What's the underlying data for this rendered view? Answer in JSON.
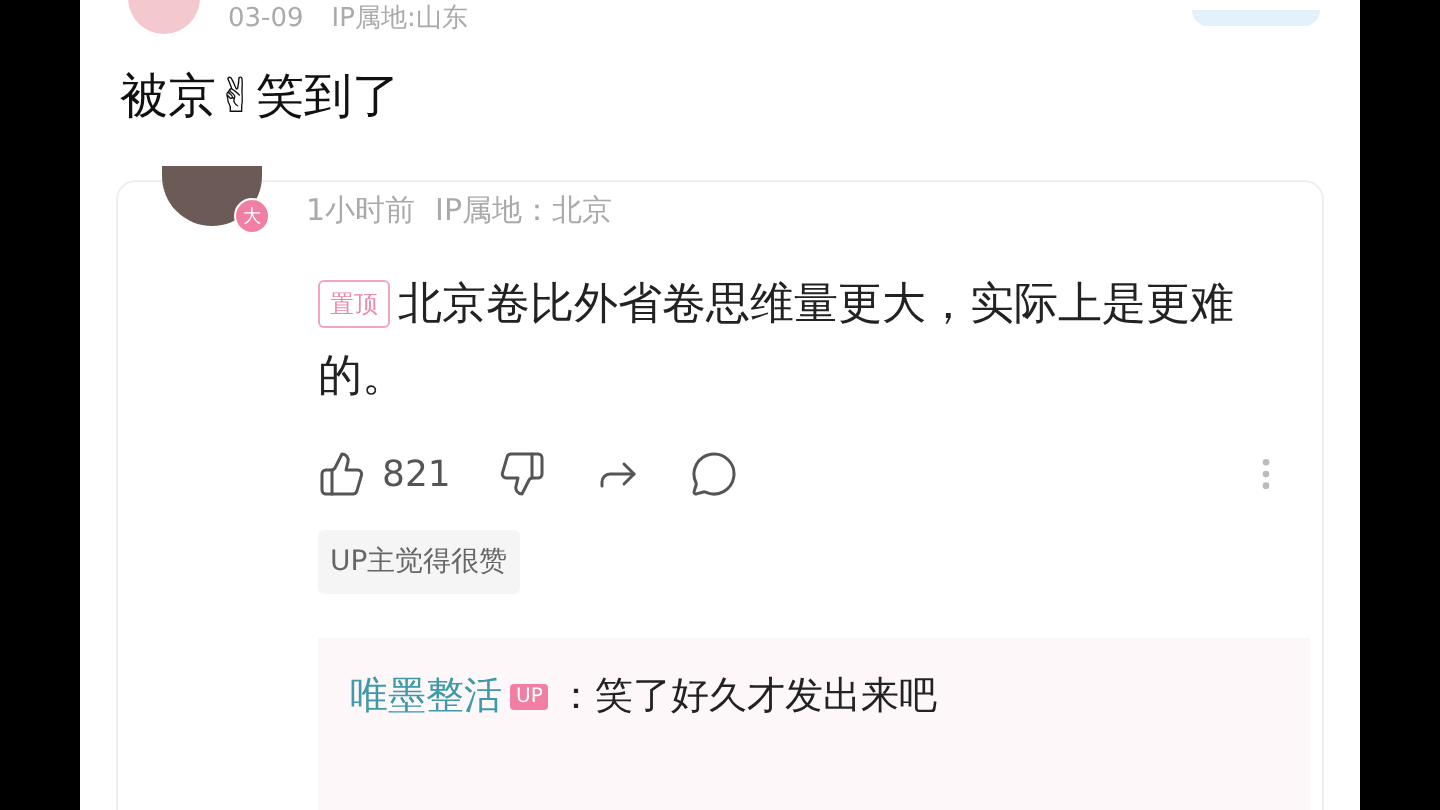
{
  "post": {
    "date": "03-09",
    "ip": "IP属地:山东",
    "title": "被京✌笑到了"
  },
  "comment": {
    "avatar_badge": "大",
    "time": "1小时前",
    "ip": "IP属地：北京",
    "pinned": true,
    "pin_label": "置顶",
    "text": "北京卷比外省卷思维量更大，实际上是更难的。",
    "likes": "821",
    "up_liked": true,
    "up_tag": "UP主觉得很赞",
    "replies": [
      {
        "author": "唯墨整活",
        "badge": "UP",
        "text": "：笑了好久才发出来吧"
      }
    ]
  }
}
